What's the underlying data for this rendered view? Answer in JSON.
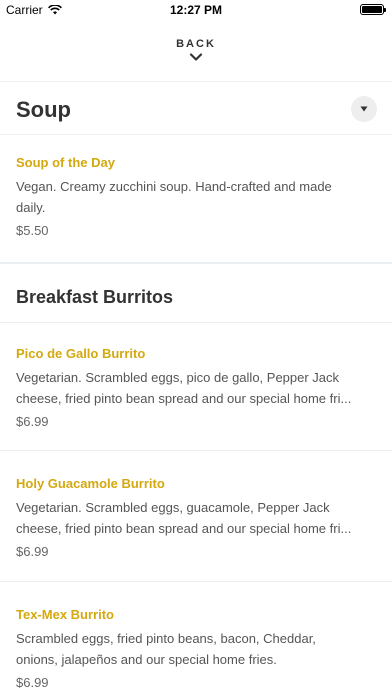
{
  "status_bar": {
    "carrier": "Carrier",
    "time": "12:27 PM"
  },
  "header": {
    "back_label": "BACK"
  },
  "sections": [
    {
      "title": "Soup",
      "items": [
        {
          "name": "Soup of the Day",
          "desc_lines": [
            "Vegan. Creamy zucchini soup. Hand-crafted and made",
            "daily."
          ],
          "price": "$5.50"
        }
      ]
    },
    {
      "title": "Breakfast Burritos",
      "items": [
        {
          "name": "Pico de Gallo Burrito",
          "desc_lines": [
            "Vegetarian. Scrambled eggs, pico de gallo, Pepper Jack",
            "cheese, fried pinto bean spread and our special home fri..."
          ],
          "price": "$6.99"
        },
        {
          "name": "Holy Guacamole Burrito",
          "desc_lines": [
            "Vegetarian. Scrambled eggs, guacamole, Pepper Jack",
            "cheese, fried pinto bean spread and our special home fri..."
          ],
          "price": "$6.99"
        },
        {
          "name": "Tex-Mex Burrito",
          "desc_lines": [
            "Scrambled eggs, fried pinto beans, bacon, Cheddar,",
            "onions, jalapeños and our special home fries."
          ],
          "price": "$6.99"
        }
      ]
    }
  ],
  "colors": {
    "accent": "#d4a80f",
    "divider": "#eceff1"
  }
}
